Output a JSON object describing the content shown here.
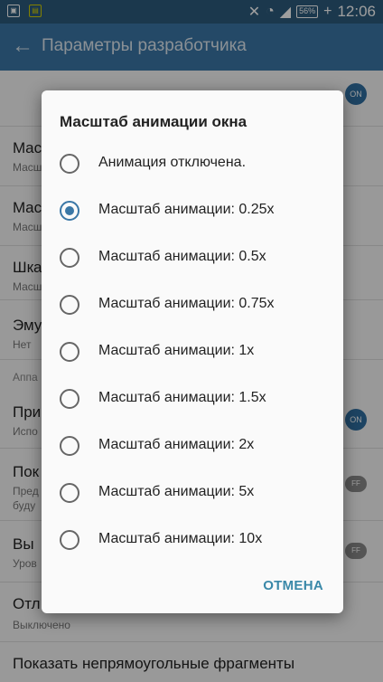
{
  "status_bar": {
    "notif_icon_1": "notification-icon",
    "notif_icon_2": "sim-icon",
    "battery": "56%",
    "time": "12:06"
  },
  "app_bar": {
    "title": "Параметры разработчика"
  },
  "background_rows": {
    "r1_title": "Mac",
    "r1_sub": "Масш",
    "r2_title": "Mac",
    "r2_sub": "Масш",
    "r3_title": "Шкa",
    "r3_sub": "Масш",
    "r4_title": "Эму",
    "r4_sub": "Нет",
    "section": "Аппа",
    "r5_title": "При",
    "r5_sub": "Испо",
    "r6_title": "Пок",
    "r6_sub1": "Пред",
    "r6_sub2": "буду",
    "r7_title": "Вы",
    "r7_sub": "Уров",
    "r8_title": "Отл",
    "r8_sub": "Выключено",
    "r9_title": "Показать непрямоугольные фрагменты",
    "toggle_on": "ON",
    "toggle_off": "FF"
  },
  "dialog": {
    "title": "Масштаб анимации окна",
    "selected_index": 1,
    "options": [
      "Анимация отключена.",
      "Масштаб анимации: 0.25x",
      "Масштаб анимации: 0.5x",
      "Масштаб анимации: 0.75x",
      "Масштаб анимации: 1x",
      "Масштаб анимации: 1.5x",
      "Масштаб анимации: 2x",
      "Масштаб анимации: 5x",
      "Масштаб анимации: 10x"
    ],
    "cancel_label": "ОТМЕНА"
  },
  "colors": {
    "app_bar": "#3a77a6",
    "status_bar": "#2c5b7c",
    "accent": "#3a77a6",
    "cancel_text": "#3a88a8"
  }
}
